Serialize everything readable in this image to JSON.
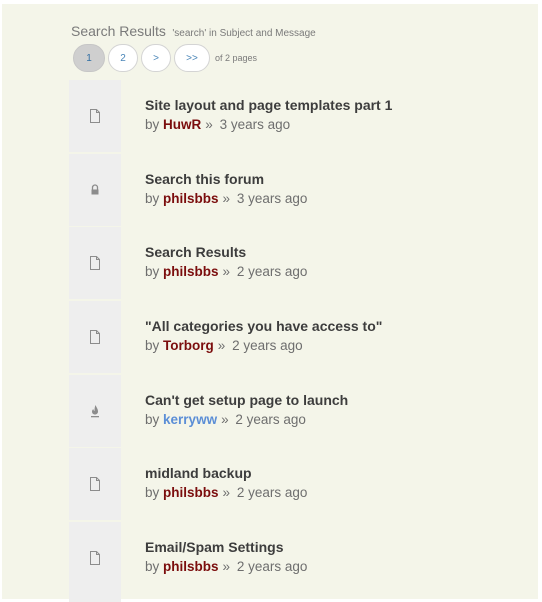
{
  "header": {
    "title": "Search Results",
    "subtitle": "'search' in Subject and Message"
  },
  "pagination": {
    "buttons": [
      {
        "label": "1",
        "active": true
      },
      {
        "label": "2",
        "active": false
      },
      {
        "label": ">",
        "active": false
      },
      {
        "label": ">>",
        "active": false
      }
    ],
    "info": "of 2 pages"
  },
  "results": [
    {
      "title": "Site layout and page templates part 1",
      "by": "by",
      "author": "HuwR",
      "sep": "»",
      "time": "3 years ago",
      "icon": "document-icon"
    },
    {
      "title": "Search this forum",
      "by": "by",
      "author": "philsbbs",
      "sep": "»",
      "time": "3 years ago",
      "icon": "lock-icon"
    },
    {
      "title": "Search Results",
      "by": "by",
      "author": "philsbbs",
      "sep": "»",
      "time": "2 years ago",
      "icon": "document-icon"
    },
    {
      "title": "\"All categories you have access to\"",
      "by": "by",
      "author": "Torborg",
      "sep": "»",
      "time": "2 years ago",
      "icon": "document-icon"
    },
    {
      "title": "Can't get setup page to launch",
      "by": "by",
      "author": "kerryww",
      "sep": "»",
      "time": "2 years ago",
      "icon": "fire-icon"
    },
    {
      "title": "midland backup",
      "by": "by",
      "author": "philsbbs",
      "sep": "»",
      "time": "2 years ago",
      "icon": "document-icon"
    },
    {
      "title": "Email/Spam Settings",
      "by": "by",
      "author": "philsbbs",
      "sep": "»",
      "time": "2 years ago",
      "icon": "document-icon"
    }
  ],
  "colors": {
    "background": "#f4f5e9",
    "author": "#7b0d0d",
    "author_highlight": "#5b8ed6",
    "link": "#4a86b8"
  }
}
